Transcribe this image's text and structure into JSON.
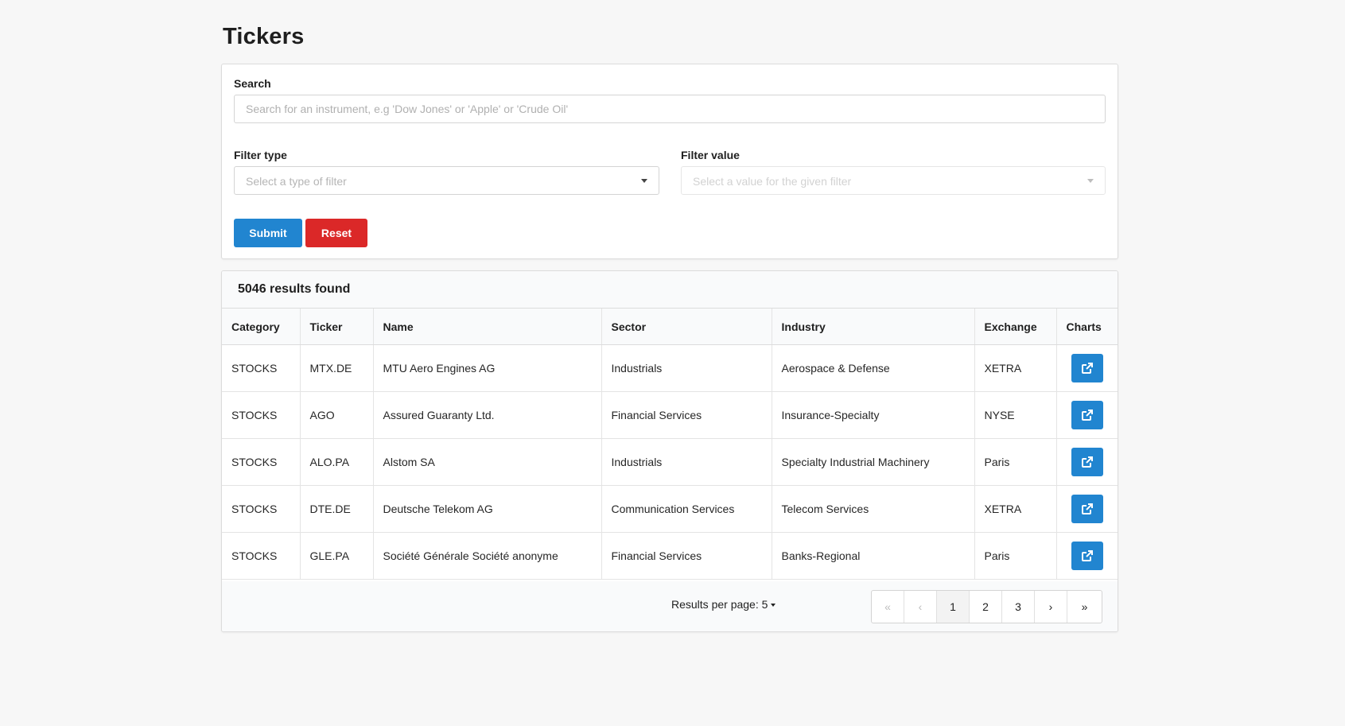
{
  "page": {
    "title": "Tickers"
  },
  "search": {
    "label": "Search",
    "placeholder": "Search for an instrument, e.g 'Dow Jones' or 'Apple' or 'Crude Oil'",
    "value": ""
  },
  "filters": {
    "type": {
      "label": "Filter type",
      "placeholder": "Select a type of filter"
    },
    "value": {
      "label": "Filter value",
      "placeholder": "Select a value for the given filter",
      "disabled": true
    }
  },
  "actions": {
    "submit_label": "Submit",
    "reset_label": "Reset"
  },
  "results": {
    "count_text": "5046 results found",
    "columns": [
      "Category",
      "Ticker",
      "Name",
      "Sector",
      "Industry",
      "Exchange",
      "Charts"
    ],
    "rows": [
      {
        "category": "STOCKS",
        "ticker": "MTX.DE",
        "name": "MTU Aero Engines AG",
        "sector": "Industrials",
        "industry": "Aerospace & Defense",
        "exchange": "XETRA"
      },
      {
        "category": "STOCKS",
        "ticker": "AGO",
        "name": "Assured Guaranty Ltd.",
        "sector": "Financial Services",
        "industry": "Insurance-Specialty",
        "exchange": "NYSE"
      },
      {
        "category": "STOCKS",
        "ticker": "ALO.PA",
        "name": "Alstom SA",
        "sector": "Industrials",
        "industry": "Specialty Industrial Machinery",
        "exchange": "Paris"
      },
      {
        "category": "STOCKS",
        "ticker": "DTE.DE",
        "name": "Deutsche Telekom AG",
        "sector": "Communication Services",
        "industry": "Telecom Services",
        "exchange": "XETRA"
      },
      {
        "category": "STOCKS",
        "ticker": "GLE.PA",
        "name": "Société Générale Société anonyme",
        "sector": "Financial Services",
        "industry": "Banks-Regional",
        "exchange": "Paris"
      }
    ]
  },
  "pagination": {
    "per_page_label": "Results per page: 5",
    "first": "«",
    "prev": "‹",
    "pages": [
      "1",
      "2",
      "3"
    ],
    "current": "1",
    "next": "›",
    "last": "»"
  },
  "colors": {
    "primary": "#2185d0",
    "danger": "#db2828",
    "background": "#f7f7f7"
  },
  "icons": {
    "chart": "external-link-icon",
    "dropdown": "caret-down-icon"
  }
}
